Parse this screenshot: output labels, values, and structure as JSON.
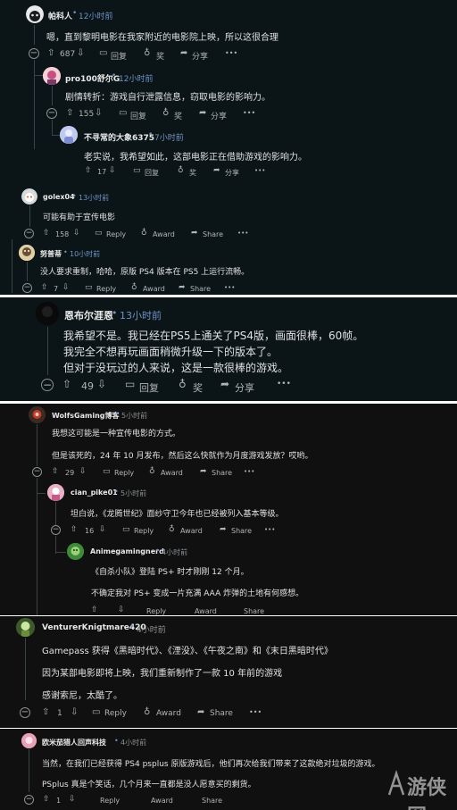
{
  "colors": {
    "panel_dark_blue": "#0b1416",
    "panel_dark": "#101010",
    "time_blue": "#6f93c8",
    "text": "#dfe1e3"
  },
  "comments": [
    {
      "author": "帕科人",
      "time": "12小时前",
      "text": "嗯，直到黎明电影在我家附近的电影院上映，所以这很合理",
      "upvotes": "687",
      "reply": "回复",
      "award": "奖",
      "share": "分享",
      "more": "•••"
    },
    {
      "author": "pro100舒尔G",
      "time": "12小时前",
      "text": "剧情转折：游戏自行泄露信息，窃取电影的影响力。",
      "upvotes": "155",
      "reply": "回复",
      "award": "奖",
      "share": "分享",
      "more": "•••"
    },
    {
      "author": "不寻常的大象6375",
      "time": "7小时前",
      "text": "老实说，我希望如此，这部电影正在借助游戏的影响力。",
      "upvotes": "17",
      "reply": "回复",
      "award": "奖",
      "share": "分享",
      "more": "•••"
    },
    {
      "author": "golex04",
      "time": "13小时前",
      "text": "可能有助于宣传电影",
      "upvotes": "158",
      "reply": "Reply",
      "award": "Award",
      "share": "Share",
      "more": "•••"
    },
    {
      "author": "努普蒂",
      "time": "10小时前",
      "text": "没人要求重制，哈哈，原版 PS4 版本在 PS5 上运行流畅。",
      "upvotes": "7",
      "reply": "Reply",
      "award": "Award",
      "share": "Share",
      "more": "•••"
    },
    {
      "author": "恩布尔涯恩",
      "time": "13小时前",
      "lines": [
        "我希望不是。我已经在PS5上通关了PS4版，画面很棒，60帧。",
        "我完全不想再玩画面稍微升级一下的版本了。",
        "但对于没玩过的人来说，这是一款很棒的游戏。"
      ],
      "upvotes": "49",
      "reply": "回复",
      "award": "奖",
      "share": "分享",
      "more": "•••"
    },
    {
      "author": "WolfsGaming博客",
      "time": "5小时前",
      "lines": [
        "我想这可能是一种宣传电影的方式。",
        "但是该死的，24 年 10 月发布，然后这么快就作为月度游戏发放？哎哟。"
      ],
      "upvotes": "29",
      "reply": "Reply",
      "award": "Award",
      "share": "Share",
      "more": "•••"
    },
    {
      "author": "cian_pike01",
      "time": "5小时前",
      "text": "坦白说，《龙腾世纪》面纱守卫今年也已经被列入基本等级。",
      "upvotes": "16",
      "reply": "Reply",
      "award": "Award",
      "share": "Share",
      "more": "•••"
    },
    {
      "author": "Animegamingnerd",
      "time": "4小时前",
      "lines": [
        "《自杀小队》登陆 PS+ 时才刚刚 12 个月。",
        "不确定我对 PS+ 变成一片充满 AAA 炸弹的土地有何感想。"
      ],
      "upvotes": "",
      "reply": "Reply",
      "award": "Award",
      "share": "Share"
    },
    {
      "author": "VenturerKnigtmare420",
      "time": "4小时前",
      "lines": [
        "Gamepass 获得《黑暗时代》、《湮没》、《午夜之南》和《末日黑暗时代》",
        "因为某部电影即将上映，我们重新制作了一款 10 年前的游戏",
        "感谢索尼，太酷了。"
      ],
      "upvotes": "1",
      "reply": "Reply",
      "award": "Award",
      "share": "Share",
      "more": "•••"
    },
    {
      "author": "欧米茄猎人回声科技",
      "time": "4小时前",
      "lines": [
        "当然，在我们已经获得 PS4 psplus 原版游戏后，他们再次给我们带来了这款绝对垃圾的游戏。",
        "PSplus 真是个笑话，几个月来一直都是没人愿意买的剩货。"
      ],
      "upvotes": "1",
      "reply": "Reply",
      "award": "Award",
      "share": "Share"
    }
  ],
  "watermark": {
    "text": "游侠网",
    "icon": "watermark-logo"
  }
}
